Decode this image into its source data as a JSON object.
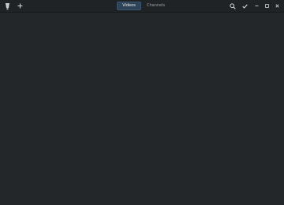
{
  "header": {
    "tabs": [
      {
        "label": "Videos",
        "active": true
      },
      {
        "label": "Channels",
        "active": false
      }
    ]
  },
  "icons": {
    "app": "app-logo-icon",
    "add": "plus-icon",
    "search": "search-icon",
    "selection": "check-icon",
    "minimize": "minimize-icon",
    "maximize": "maximize-icon",
    "close": "close-icon"
  },
  "colors": {
    "window_bg": "#242729",
    "header_bg": "#202325",
    "active_tab_bg": "#2f4357",
    "icon": "#d6dadd"
  }
}
